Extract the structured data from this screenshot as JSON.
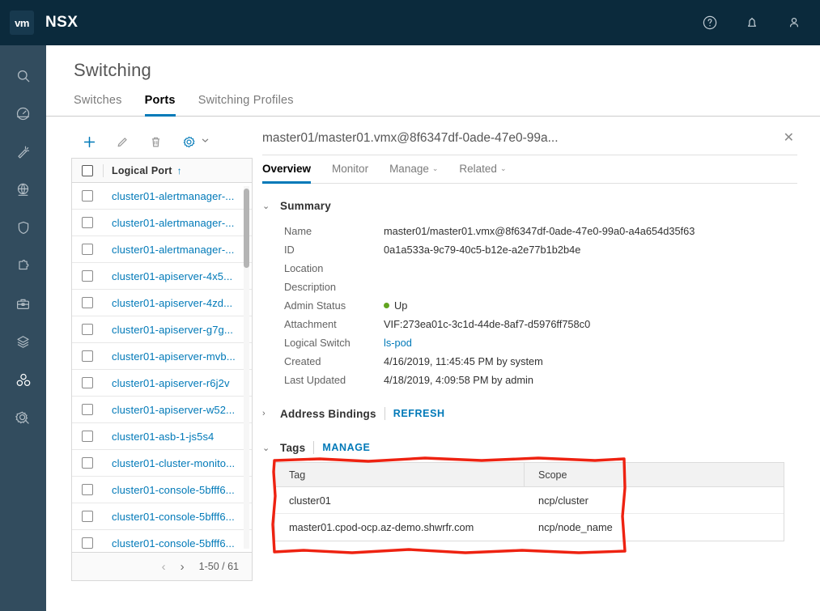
{
  "app": {
    "logo_text": "vm",
    "brand": "NSX"
  },
  "topbar": {
    "icons": [
      {
        "name": "help-icon",
        "label": "Help"
      },
      {
        "name": "bell-icon",
        "label": "Notifications"
      },
      {
        "name": "user-icon",
        "label": "User account"
      }
    ]
  },
  "rail": {
    "items": [
      {
        "name": "search-icon",
        "label": "Search",
        "active": false
      },
      {
        "name": "dashboard-icon",
        "label": "Dashboard",
        "active": false
      },
      {
        "name": "wand-icon",
        "label": "Get Started",
        "active": false
      },
      {
        "name": "networking-icon",
        "label": "Networking",
        "active": false
      },
      {
        "name": "shield-icon",
        "label": "Security",
        "active": false
      },
      {
        "name": "puzzle-icon",
        "label": "Inventory",
        "active": false
      },
      {
        "name": "toolbox-icon",
        "label": "Tools",
        "active": false
      },
      {
        "name": "layers-icon",
        "label": "Plan and Troubleshoot",
        "active": false
      },
      {
        "name": "cubes-icon",
        "label": "Switching",
        "active": true
      },
      {
        "name": "gear-icon",
        "label": "System",
        "active": false
      }
    ]
  },
  "page": {
    "title": "Switching",
    "tabs": [
      {
        "label": "Switches",
        "active": false
      },
      {
        "label": "Ports",
        "active": true
      },
      {
        "label": "Switching Profiles",
        "active": false
      }
    ]
  },
  "grid": {
    "toolbar": [
      {
        "name": "add-button",
        "glyph": "+"
      },
      {
        "name": "edit-button",
        "glyph": "pencil"
      },
      {
        "name": "delete-button",
        "glyph": "trash"
      },
      {
        "name": "settings-button",
        "glyph": "gear"
      }
    ],
    "column_header": "Logical Port",
    "sort_arrow": "↑",
    "rows": [
      {
        "name": "cluster01-alertmanager-..."
      },
      {
        "name": "cluster01-alertmanager-..."
      },
      {
        "name": "cluster01-alertmanager-..."
      },
      {
        "name": "cluster01-apiserver-4x5..."
      },
      {
        "name": "cluster01-apiserver-4zd..."
      },
      {
        "name": "cluster01-apiserver-g7g..."
      },
      {
        "name": "cluster01-apiserver-mvb..."
      },
      {
        "name": "cluster01-apiserver-r6j2v"
      },
      {
        "name": "cluster01-apiserver-w52..."
      },
      {
        "name": "cluster01-asb-1-js5s4"
      },
      {
        "name": "cluster01-cluster-monito..."
      },
      {
        "name": "cluster01-console-5bfff6..."
      },
      {
        "name": "cluster01-console-5bfff6..."
      },
      {
        "name": "cluster01-console-5bfff6..."
      }
    ],
    "pagination": {
      "prev": "‹",
      "next": "›",
      "info": "1-50 / 61"
    }
  },
  "detail": {
    "title": "master01/master01.vmx@8f6347df-0ade-47e0-99a...",
    "close": "✕",
    "tabs": [
      {
        "label": "Overview",
        "active": true,
        "caret": false
      },
      {
        "label": "Monitor",
        "active": false,
        "caret": false
      },
      {
        "label": "Manage",
        "active": false,
        "caret": true
      },
      {
        "label": "Related",
        "active": false,
        "caret": true
      }
    ],
    "summary": {
      "label": "Summary",
      "chevron": "⌄",
      "fields": [
        {
          "key": "Name",
          "value": "master01/master01.vmx@8f6347df-0ade-47e0-99a0-a4a654d35f63",
          "type": "text"
        },
        {
          "key": "ID",
          "value": "0a1a533a-9c79-40c5-b12e-a2e77b1b2b4e",
          "type": "text"
        },
        {
          "key": "Location",
          "value": "",
          "type": "text"
        },
        {
          "key": "Description",
          "value": "",
          "type": "text"
        },
        {
          "key": "Admin Status",
          "value": "Up",
          "type": "status"
        },
        {
          "key": "Attachment",
          "value": "VIF:273ea01c-3c1d-44de-8af7-d5976ff758c0",
          "type": "text"
        },
        {
          "key": "Logical Switch",
          "value": "ls-pod",
          "type": "link"
        },
        {
          "key": "Created",
          "value": "4/16/2019, 11:45:45 PM by system",
          "type": "text"
        },
        {
          "key": "Last Updated",
          "value": "4/18/2019, 4:09:58 PM by admin",
          "type": "text"
        }
      ]
    },
    "address_bindings": {
      "label": "Address Bindings",
      "chevron": "›",
      "action": "REFRESH"
    },
    "tags": {
      "label": "Tags",
      "chevron": "⌄",
      "action": "MANAGE",
      "columns": [
        "Tag",
        "Scope"
      ],
      "rows": [
        {
          "tag": "cluster01",
          "scope": "ncp/cluster"
        },
        {
          "tag": "master01.cpod-ocp.az-demo.shwrfr.com",
          "scope": "ncp/node_name"
        }
      ]
    }
  },
  "colors": {
    "topbar_bg": "#0b2a3c",
    "rail_bg": "#324c5e",
    "accent": "#0079b8",
    "status_up": "#62a420",
    "annotation": "#ee2211"
  }
}
